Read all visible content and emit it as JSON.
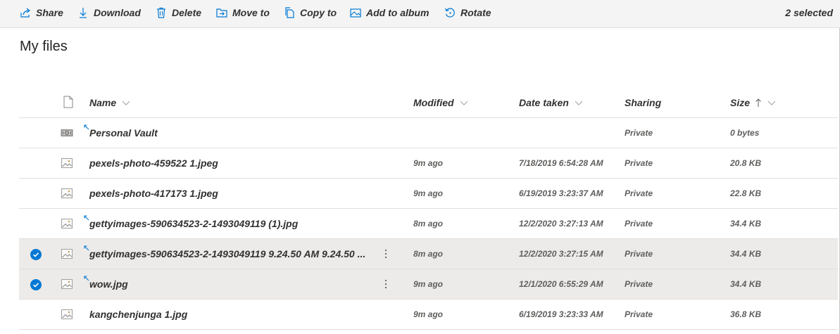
{
  "toolbar": {
    "share": "Share",
    "download": "Download",
    "delete": "Delete",
    "move_to": "Move to",
    "copy_to": "Copy to",
    "add_to_album": "Add to album",
    "rotate": "Rotate",
    "selected_count": "2 selected"
  },
  "page": {
    "title": "My files"
  },
  "table": {
    "columns": {
      "name": "Name",
      "modified": "Modified",
      "date_taken": "Date taken",
      "sharing": "Sharing",
      "size": "Size"
    },
    "sort": {
      "column": "size",
      "direction": "ascending"
    },
    "rows": [
      {
        "name": "Personal Vault",
        "modified": "",
        "date_taken": "",
        "sharing": "Private",
        "size": "0 bytes",
        "icon": "vault-icon",
        "selected": false,
        "sync": true
      },
      {
        "name": "pexels-photo-459522 1.jpeg",
        "modified": "9m ago",
        "date_taken": "7/18/2019 6:54:28 AM",
        "sharing": "Private",
        "size": "20.8 KB",
        "icon": "image-file-icon",
        "selected": false,
        "sync": false
      },
      {
        "name": "pexels-photo-417173 1.jpeg",
        "modified": "9m ago",
        "date_taken": "6/19/2019 3:23:37 AM",
        "sharing": "Private",
        "size": "22.8 KB",
        "icon": "image-file-icon",
        "selected": false,
        "sync": false
      },
      {
        "name": "gettyimages-590634523-2-1493049119 (1).jpg",
        "modified": "8m ago",
        "date_taken": "12/2/2020 3:27:13 AM",
        "sharing": "Private",
        "size": "34.4 KB",
        "icon": "image-file-icon",
        "selected": false,
        "sync": true
      },
      {
        "name": "gettyimages-590634523-2-1493049119 9.24.50 AM 9.24.50 ...",
        "modified": "8m ago",
        "date_taken": "12/2/2020 3:27:15 AM",
        "sharing": "Private",
        "size": "34.4 KB",
        "icon": "image-file-icon",
        "selected": true,
        "sync": true
      },
      {
        "name": "wow.jpg",
        "modified": "9m ago",
        "date_taken": "12/1/2020 6:55:29 AM",
        "sharing": "Private",
        "size": "34.4 KB",
        "icon": "image-file-icon",
        "selected": true,
        "sync": true
      },
      {
        "name": "kangchenjunga 1.jpg",
        "modified": "9m ago",
        "date_taken": "6/19/2019 3:23:33 AM",
        "sharing": "Private",
        "size": "36.8 KB",
        "icon": "image-file-icon",
        "selected": false,
        "sync": false
      }
    ]
  },
  "colors": {
    "accent": "#0078d4",
    "selected_row": "#edebe9",
    "toolbar_bg": "#f4f4f4"
  }
}
